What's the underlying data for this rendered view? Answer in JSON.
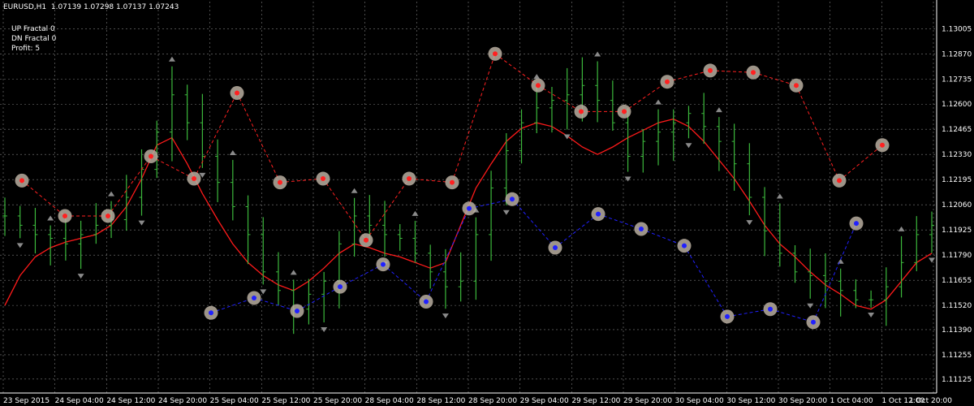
{
  "header": {
    "symbol": "EURUSD,H1",
    "ohlc": "1.07139 1.07298 1.07137 1.07243"
  },
  "indicator": {
    "up_fractal": "UP Fractal 0",
    "dn_fractal": "DN Fractal 0",
    "profit": "Profit: 5"
  },
  "colors": {
    "background": "#000000",
    "grid": "#e6e6e6",
    "axis": "#ffffff",
    "bar": "#3cb83c",
    "ma": "#ff1a1a",
    "sell_line": "#ff2020",
    "buy_line": "#2020ff",
    "marker_ring": "#b9aea0",
    "fractal_arrow": "#8a8a8a"
  },
  "chart_data": {
    "type": "ohlc",
    "grid": true,
    "ylim": [
      1.1105,
      1.1315
    ],
    "y_ticks": [
      "1.13005",
      "1.12870",
      "1.12735",
      "1.12600",
      "1.12465",
      "1.12330",
      "1.12195",
      "1.12060",
      "1.11925",
      "1.11790",
      "1.11655",
      "1.11520",
      "1.11390",
      "1.11255",
      "1.11125"
    ],
    "x_ticks": [
      "23 Sep 2015",
      "24 Sep 04:00",
      "24 Sep 12:00",
      "24 Sep 20:00",
      "25 Sep 04:00",
      "25 Sep 12:00",
      "25 Sep 20:00",
      "28 Sep 04:00",
      "28 Sep 12:00",
      "28 Sep 20:00",
      "29 Sep 04:00",
      "29 Sep 12:00",
      "29 Sep 20:00",
      "30 Sep 04:00",
      "30 Sep 12:00",
      "30 Sep 20:00",
      "1 Oct 04:00",
      "1 Oct 12:00",
      "1 Oct 20:00"
    ],
    "close_series": [
      1.12,
      1.1195,
      1.119,
      1.1188,
      1.1185,
      1.119,
      1.1195,
      1.1198,
      1.121,
      1.1225,
      1.1245,
      1.1265,
      1.125,
      1.1232,
      1.1218,
      1.1205,
      1.119,
      1.117,
      1.116,
      1.115,
      1.1158,
      1.1165,
      1.1185,
      1.12,
      1.1195,
      1.119,
      1.1188,
      1.118,
      1.117,
      1.1162,
      1.1165,
      1.119,
      1.1215,
      1.1235,
      1.125,
      1.1258,
      1.1262,
      1.1265,
      1.127,
      1.1262,
      1.125,
      1.1232,
      1.124,
      1.1245,
      1.125,
      1.1255,
      1.1248,
      1.124,
      1.1228,
      1.121,
      1.1192,
      1.118,
      1.117,
      1.1168,
      1.1165,
      1.116,
      1.1155,
      1.1155,
      1.1162,
      1.1175,
      1.119,
      1.1195
    ],
    "ma_series": [
      1.1152,
      1.1168,
      1.1178,
      1.1183,
      1.1186,
      1.1188,
      1.119,
      1.1195,
      1.1205,
      1.122,
      1.1238,
      1.1242,
      1.1228,
      1.1212,
      1.1198,
      1.1185,
      1.1175,
      1.1168,
      1.1163,
      1.116,
      1.1165,
      1.1172,
      1.118,
      1.1185,
      1.1183,
      1.118,
      1.1178,
      1.1175,
      1.1172,
      1.1175,
      1.1195,
      1.1215,
      1.1228,
      1.124,
      1.1247,
      1.125,
      1.1248,
      1.1243,
      1.1237,
      1.1233,
      1.1237,
      1.1242,
      1.1246,
      1.125,
      1.1252,
      1.1248,
      1.124,
      1.123,
      1.122,
      1.1208,
      1.1195,
      1.1185,
      1.1178,
      1.117,
      1.1163,
      1.1158,
      1.1152,
      1.115,
      1.1155,
      1.1165,
      1.1175,
      1.118
    ],
    "sell_markers": [
      {
        "price": 1.1219
      },
      {
        "price": 1.12
      },
      {
        "price": 1.12
      },
      {
        "price": 1.1232
      },
      {
        "price": 1.122
      },
      {
        "price": 1.1266
      },
      {
        "price": 1.1218
      },
      {
        "price": 1.122
      },
      {
        "price": 1.1187
      },
      {
        "price": 1.122
      },
      {
        "price": 1.1218
      },
      {
        "price": 1.1287
      },
      {
        "price": 1.127
      },
      {
        "price": 1.1256
      },
      {
        "price": 1.1256
      },
      {
        "price": 1.1272
      },
      {
        "price": 1.1278
      },
      {
        "price": 1.1277
      },
      {
        "price": 1.127
      },
      {
        "price": 1.1219
      },
      {
        "price": 1.1238
      }
    ],
    "buy_markers": [
      {
        "price": 1.1148
      },
      {
        "price": 1.1156
      },
      {
        "price": 1.1149
      },
      {
        "price": 1.1162
      },
      {
        "price": 1.1174
      },
      {
        "price": 1.1154
      },
      {
        "price": 1.1204
      },
      {
        "price": 1.1209
      },
      {
        "price": 1.1183
      },
      {
        "price": 1.1201
      },
      {
        "price": 1.1193
      },
      {
        "price": 1.1184
      },
      {
        "price": 1.1146
      },
      {
        "price": 1.115
      },
      {
        "price": 1.1143
      },
      {
        "price": 1.1196
      }
    ]
  }
}
